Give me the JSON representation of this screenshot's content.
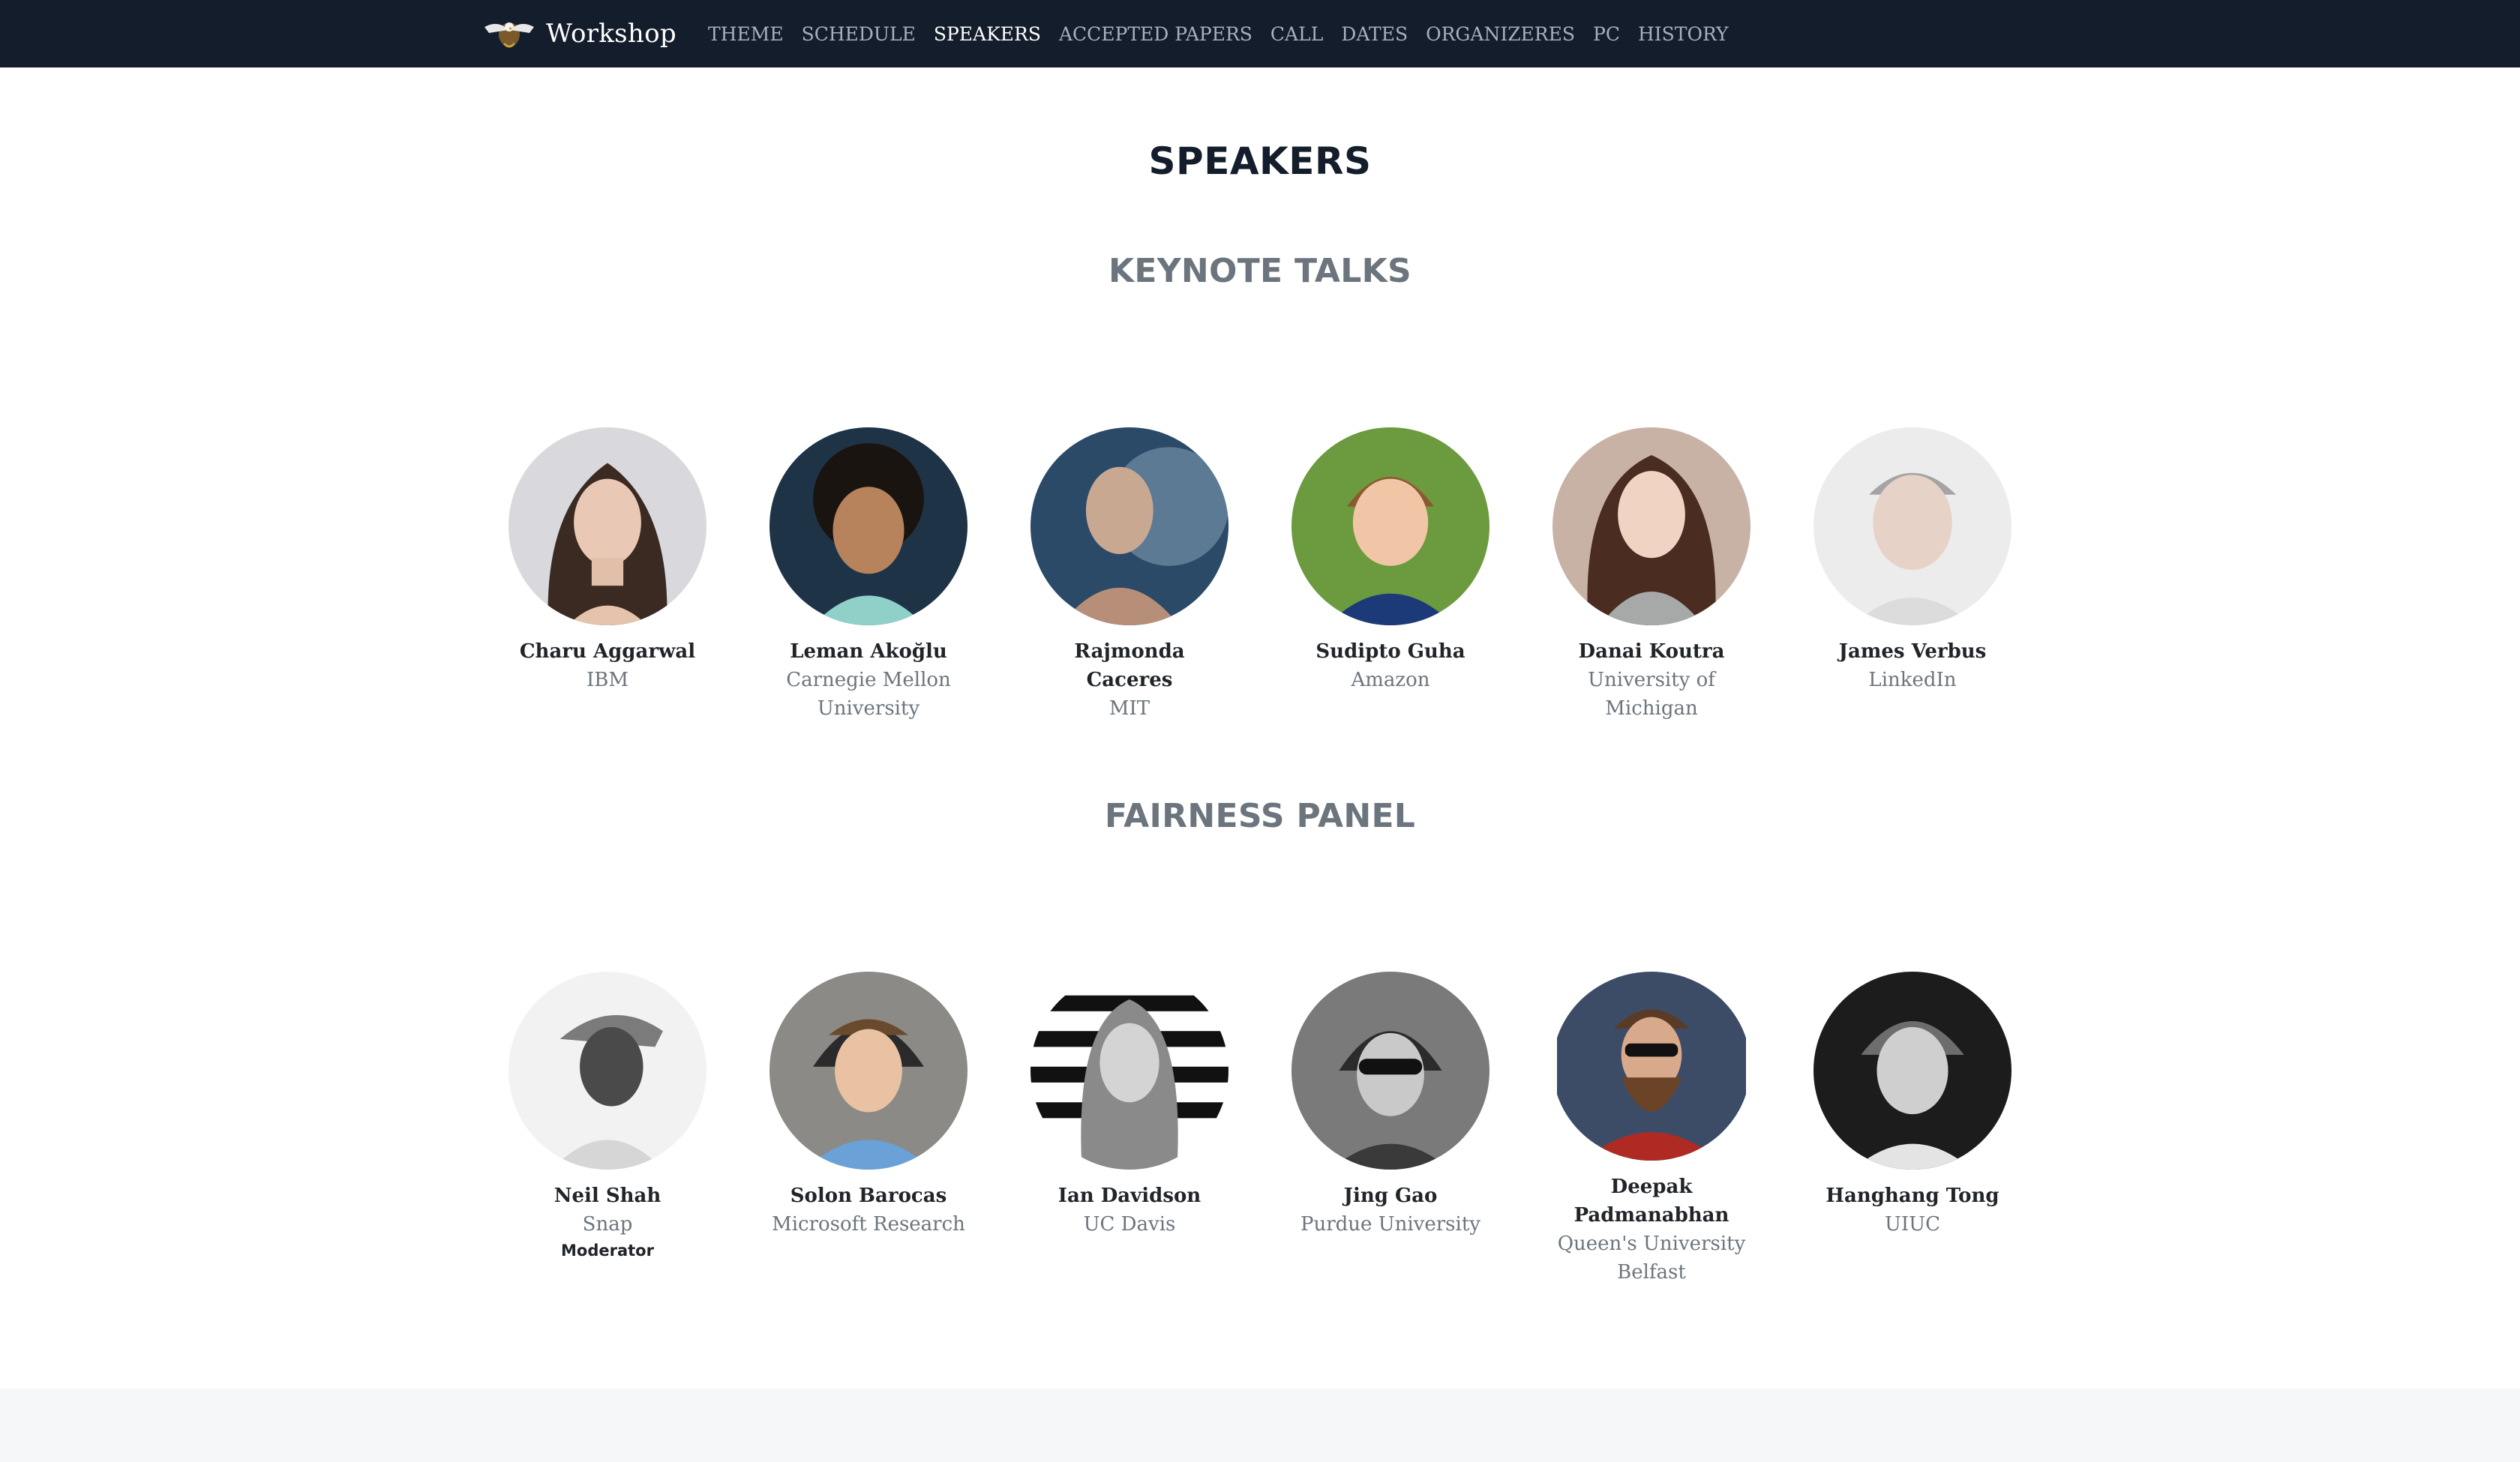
{
  "brand": {
    "name": "Workshop",
    "logo_icon": "eagle-logo-icon"
  },
  "nav": {
    "items": [
      {
        "label": "THEME",
        "active": false
      },
      {
        "label": "SCHEDULE",
        "active": false
      },
      {
        "label": "SPEAKERS",
        "active": true
      },
      {
        "label": "ACCEPTED PAPERS",
        "active": false
      },
      {
        "label": "CALL",
        "active": false
      },
      {
        "label": "DATES",
        "active": false
      },
      {
        "label": "ORGANIZERES",
        "active": false
      },
      {
        "label": "PC",
        "active": false
      },
      {
        "label": "HISTORY",
        "active": false
      }
    ]
  },
  "page": {
    "title": "SPEAKERS"
  },
  "keynote": {
    "title": "KEYNOTE TALKS",
    "speakers": [
      {
        "name": "Charu Aggarwal",
        "affiliation": "IBM"
      },
      {
        "name": "Leman Akoğlu",
        "affiliation": "Carnegie Mellon University"
      },
      {
        "name": "Rajmonda Caceres",
        "affiliation": "MIT"
      },
      {
        "name": "Sudipto Guha",
        "affiliation": "Amazon"
      },
      {
        "name": "Danai Koutra",
        "affiliation": "University of Michigan"
      },
      {
        "name": "James Verbus",
        "affiliation": "LinkedIn"
      }
    ]
  },
  "panel": {
    "title": "FAIRNESS PANEL",
    "speakers": [
      {
        "name": "Neil Shah",
        "affiliation": "Snap",
        "role": "Moderator"
      },
      {
        "name": "Solon Barocas",
        "affiliation": "Microsoft Research"
      },
      {
        "name": "Ian Davidson",
        "affiliation": "UC Davis"
      },
      {
        "name": "Jing Gao",
        "affiliation": "Purdue University"
      },
      {
        "name": "Deepak Padmanabhan",
        "affiliation": "Queen's University Belfast"
      },
      {
        "name": "Hanghang Tong",
        "affiliation": "UIUC"
      }
    ]
  },
  "colors": {
    "navbar_bg": "#131d2b",
    "nav_text": "#a8b0bb",
    "nav_active": "#ffffff",
    "title": "#131d2b",
    "section_title": "#6c757d",
    "affiliation": "#6c757d"
  }
}
